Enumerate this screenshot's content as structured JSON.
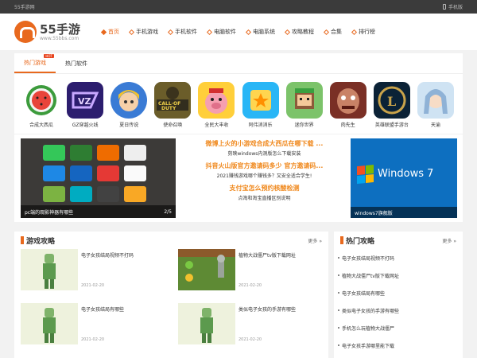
{
  "topbar": {
    "left": "55手游网",
    "right": "手机版"
  },
  "logo": {
    "title": "55手游",
    "sub": "www.55bbs.com"
  },
  "nav": [
    {
      "label": "首页"
    },
    {
      "label": "手机游戏"
    },
    {
      "label": "手机软件"
    },
    {
      "label": "电脑软件"
    },
    {
      "label": "电脑系统"
    },
    {
      "label": "攻略教程"
    },
    {
      "label": "合集"
    },
    {
      "label": "排行榜"
    }
  ],
  "tabs": {
    "games": "热门游戏",
    "badge": "HOT",
    "soft": "热门软件"
  },
  "apps": [
    {
      "name": "合成大西瓜"
    },
    {
      "name": "GZ穿越火线"
    },
    {
      "name": "夏日传说"
    },
    {
      "name": "使命召唤"
    },
    {
      "name": "全民大丰收"
    },
    {
      "name": "阿伟消消乐"
    },
    {
      "name": "迷你世界"
    },
    {
      "name": "肉先生"
    },
    {
      "name": "英雄联盟手游台"
    },
    {
      "name": "天谕"
    }
  ],
  "slider": {
    "caption": "pc端的观影神器有哪些",
    "page": "2/5"
  },
  "news": {
    "h1": "微博上火的小游戏合成大西瓜在哪下载 ...",
    "s1": "剪映windows内测版怎么下载安装",
    "h2": "抖音火山版官方邀请码多少 官方邀请码...",
    "s2": "2021赚钱游戏哪个赚钱多？又安全适合学生!",
    "h3": "支付宝怎么预约核酸检测",
    "s3": "点淘和淘宝直播区别说明"
  },
  "win": {
    "logo_text": "Windows 7",
    "caption": "windows7旗舰版"
  },
  "guides": {
    "title": "游戏攻略",
    "more": "更多 »",
    "items": [
      {
        "title": "电子女孩结局视频不打码",
        "date": "2021-02-20"
      },
      {
        "title": "植物大战僵尸tv版下载网址",
        "date": "2021-02-20"
      },
      {
        "title": "电子女孩结局有哪些",
        "date": "2021-02-20"
      },
      {
        "title": "类似电子女孩的手游有哪些",
        "date": "2021-02-20"
      }
    ]
  },
  "hot": {
    "title": "热门攻略",
    "more": "更多 »",
    "items": [
      {
        "title": "电子女孩结局视频不打码"
      },
      {
        "title": "植物大战僵尸tv版下载网址"
      },
      {
        "title": "电子女孩结局有哪些"
      },
      {
        "title": "类似电子女孩的手游有哪些"
      },
      {
        "title": "手机怎么玩植物大战僵尸"
      },
      {
        "title": "电子女孩手游哪里能下载"
      }
    ]
  }
}
